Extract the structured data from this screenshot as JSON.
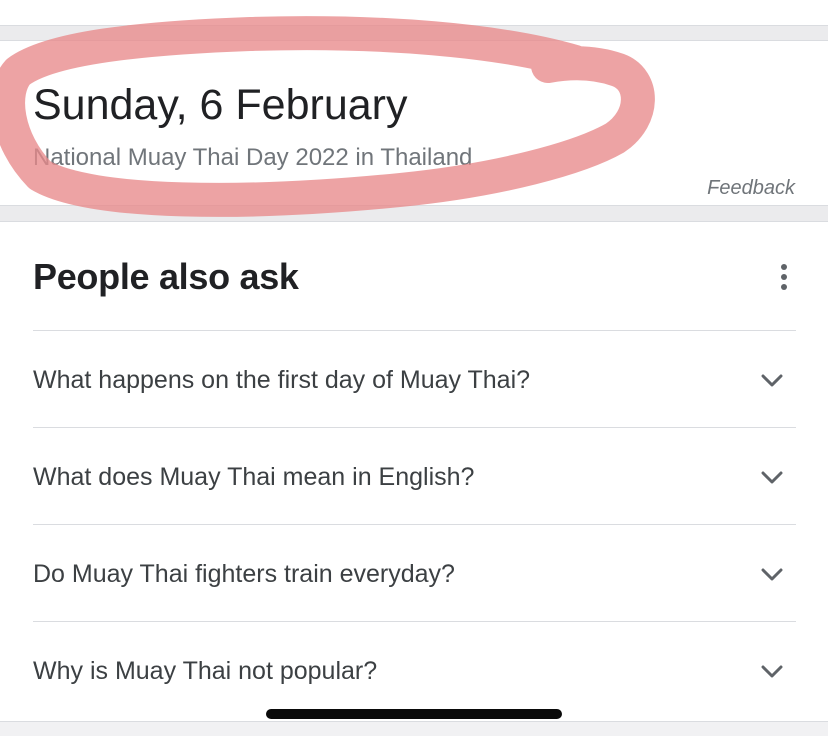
{
  "date_card": {
    "title": "Sunday, 6 February",
    "subtitle": "National Muay Thai Day 2022 in Thailand",
    "feedback_label": "Feedback"
  },
  "people_also_ask": {
    "heading": "People also ask",
    "more_icon": "more-vert-icon",
    "questions": [
      {
        "text": "What happens on the first day of Muay Thai?",
        "icon": "chevron-down-icon"
      },
      {
        "text": "What does Muay Thai mean in English?",
        "icon": "chevron-down-icon"
      },
      {
        "text": "Do Muay Thai fighters train everyday?",
        "icon": "chevron-down-icon"
      },
      {
        "text": "Why is Muay Thai not popular?",
        "icon": "chevron-down-icon"
      }
    ]
  },
  "colors": {
    "highlight": "#e8898b",
    "text_primary": "#202124",
    "text_secondary": "#70757a",
    "divider": "#dadce0",
    "page_background": "#ebebed"
  }
}
